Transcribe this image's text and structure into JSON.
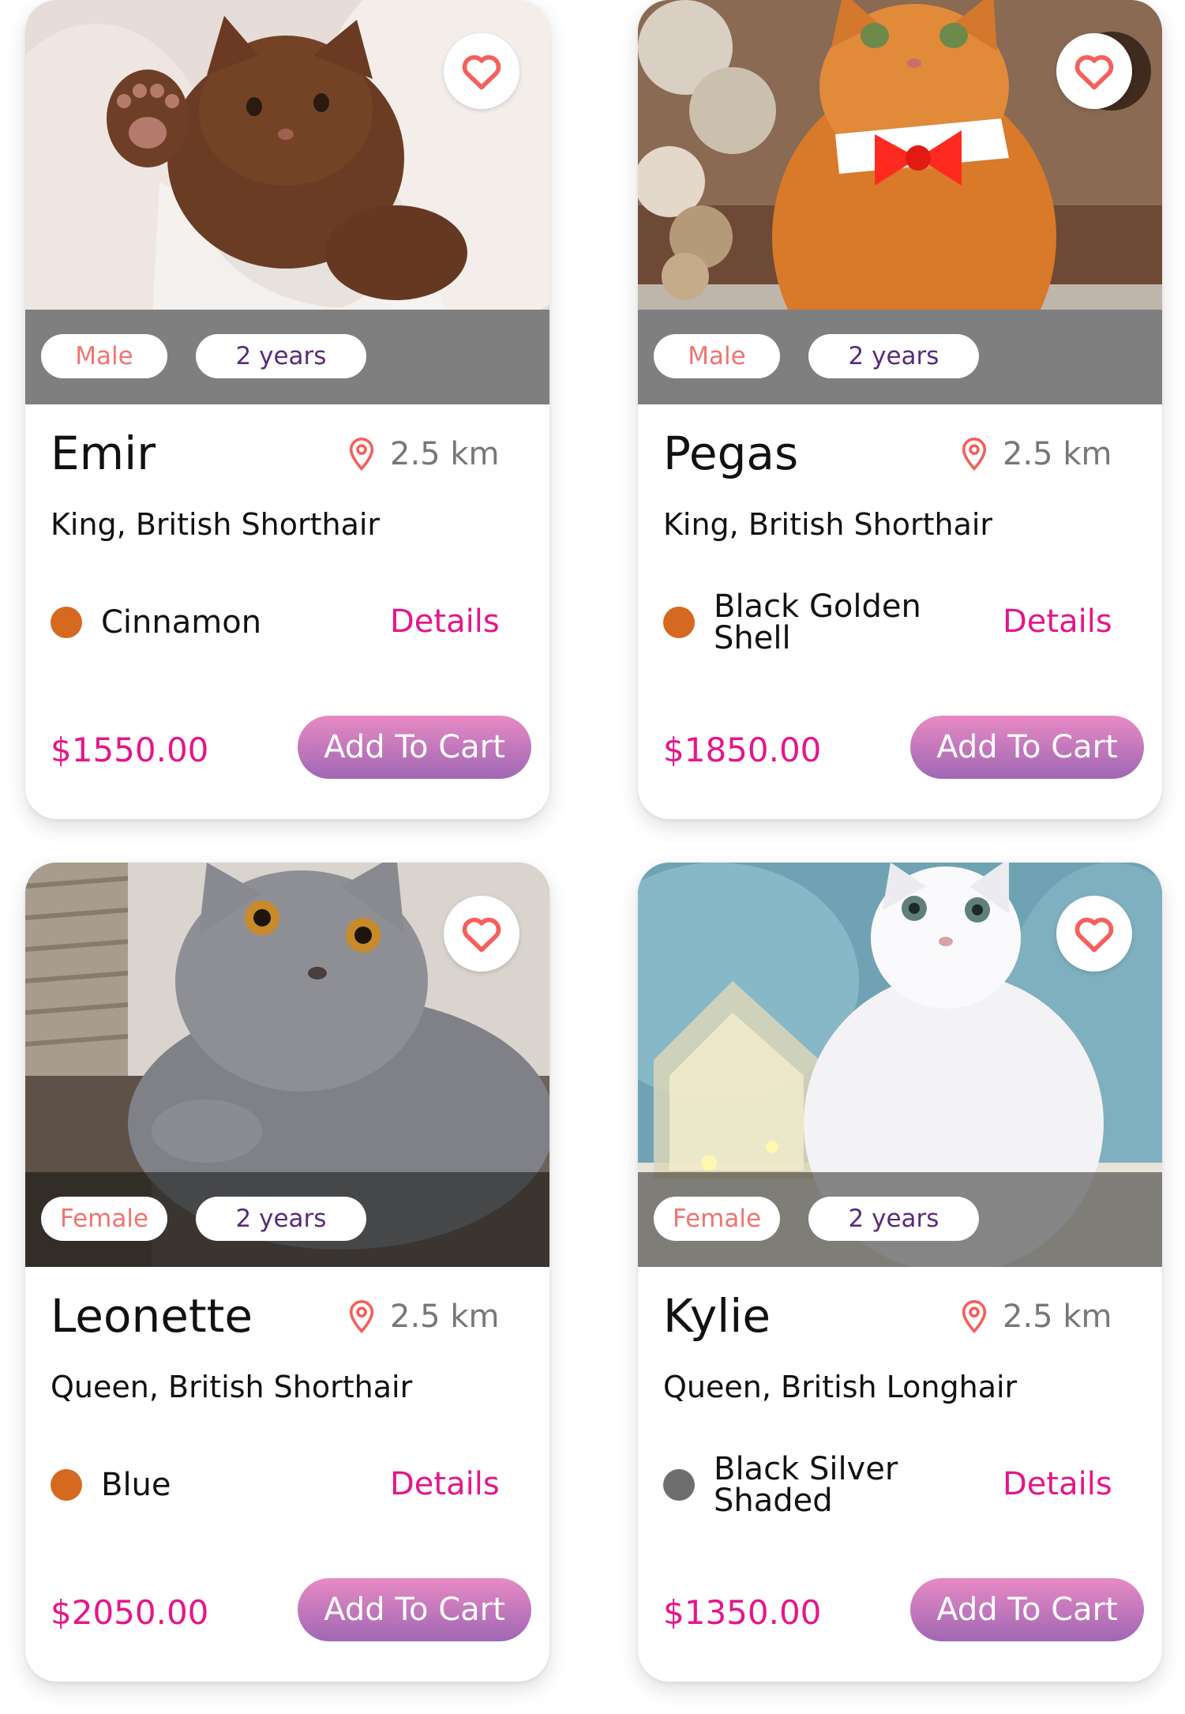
{
  "cards": [
    {
      "name": "Emir",
      "distance": "2.5 km",
      "breed": "King, British Shorthair",
      "color_name": "Cinnamon",
      "color_dot": "#d5691f",
      "details_label": "Details",
      "price": "$1550.00",
      "cart_label": "Add To Cart",
      "gender": "Male",
      "age": "2 years"
    },
    {
      "name": "Pegas",
      "distance": "2.5 km",
      "breed": "King, British Shorthair",
      "color_name": "Black Golden Shell",
      "color_dot": "#d5691f",
      "details_label": "Details",
      "price": "$1850.00",
      "cart_label": "Add To Cart",
      "gender": "Male",
      "age": "2 years"
    },
    {
      "name": "Leonette",
      "distance": "2.5 km",
      "breed": "Queen, British Shorthair",
      "color_name": "Blue",
      "color_dot": "#d5691f",
      "details_label": "Details",
      "price": "$2050.00",
      "cart_label": "Add To Cart",
      "gender": "Female",
      "age": "2 years"
    },
    {
      "name": "Kylie",
      "distance": "2.5 km",
      "breed": "Queen, British Longhair",
      "color_name": "Black Silver Shaded",
      "color_dot": "#6e6e6e",
      "details_label": "Details",
      "price": "$1350.00",
      "cart_label": "Add To Cart",
      "gender": "Female",
      "age": "2 years"
    }
  ],
  "icons": {
    "favorite": "heart-icon",
    "location": "location-pin-icon"
  },
  "colors": {
    "accent": "#e5168a",
    "button_gradient_top": "#e78ac4",
    "button_gradient_bottom": "#a067b4",
    "gender_text": "#f07470",
    "age_text": "#5a2a7a",
    "heart": "#f4605c"
  }
}
